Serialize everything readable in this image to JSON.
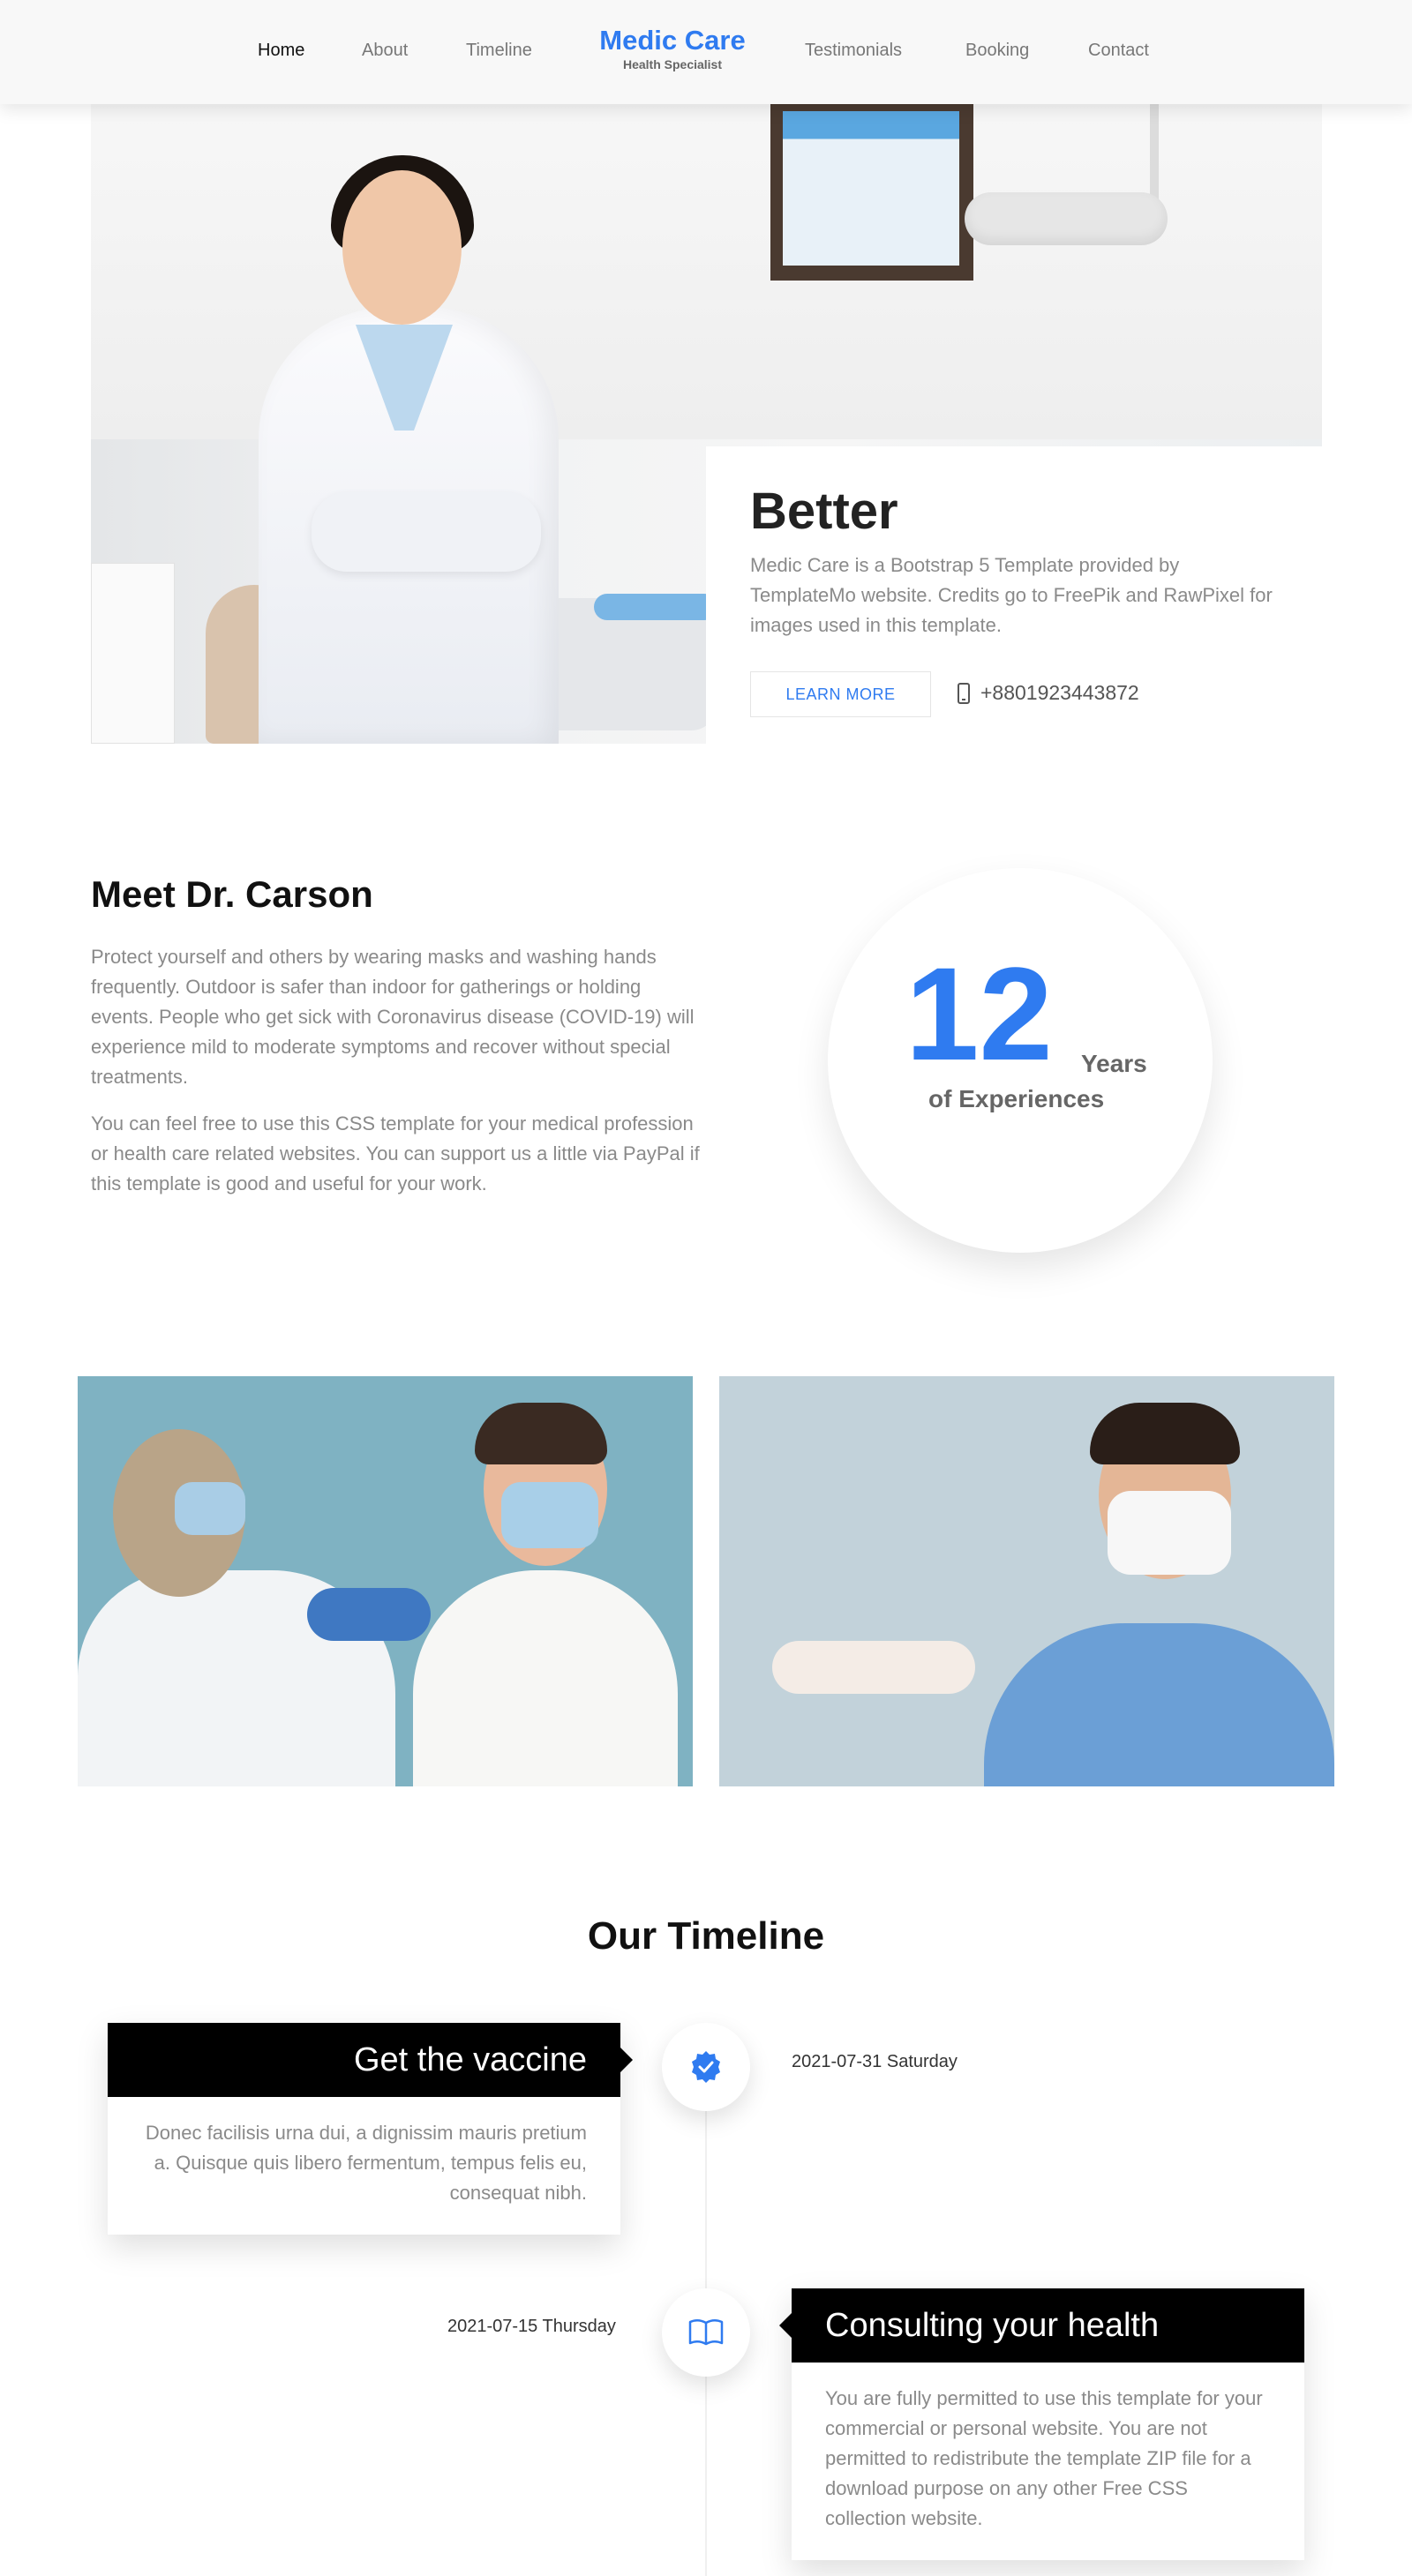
{
  "nav": {
    "links_left": [
      "Home",
      "About",
      "Timeline"
    ],
    "brand": {
      "name": "Medic Care",
      "tagline": "Health Specialist"
    },
    "links_right": [
      "Testimonials",
      "Booking",
      "Contact"
    ],
    "active": "Home"
  },
  "hero": {
    "title": "Better",
    "text": "Medic Care is a Bootstrap 5 Template provided by TemplateMo website. Credits go to FreePik and RawPixel for images used in this template.",
    "button_label": "LEARN MORE",
    "phone": "+8801923443872"
  },
  "about": {
    "title": "Meet Dr. Carson",
    "paragraphs": [
      "Protect yourself and others by wearing masks and washing hands frequently. Outdoor is safer than indoor for gatherings or holding events. People who get sick with Coronavirus disease (COVID-19) will experience mild to moderate symptoms and recover without special treatments.",
      "You can feel free to use this CSS template for your medical profession or health care related websites. You can support us a little via PayPal if this template is good and useful for your work."
    ],
    "experience": {
      "number": "12",
      "unit": "Years",
      "label": "of Experiences"
    }
  },
  "timeline": {
    "title": "Our Timeline",
    "items": [
      {
        "title": "Get the vaccine",
        "text": "Donec facilisis urna dui, a dignissim mauris pretium a. Quisque quis libero fermentum, tempus felis eu, consequat nibh.",
        "date": "2021-07-31 Saturday",
        "icon": "verified-badge-icon"
      },
      {
        "title": "Consulting your health",
        "text": "You are fully permitted to use this template for your commercial or personal website. You are not permitted to redistribute the template ZIP file for a download purpose on any other Free CSS collection website.",
        "date": "2021-07-15 Thursday",
        "icon": "open-book-icon"
      }
    ]
  },
  "colors": {
    "accent": "#2f7bf0",
    "text_muted": "#8a8a8a",
    "dark": "#000000"
  }
}
